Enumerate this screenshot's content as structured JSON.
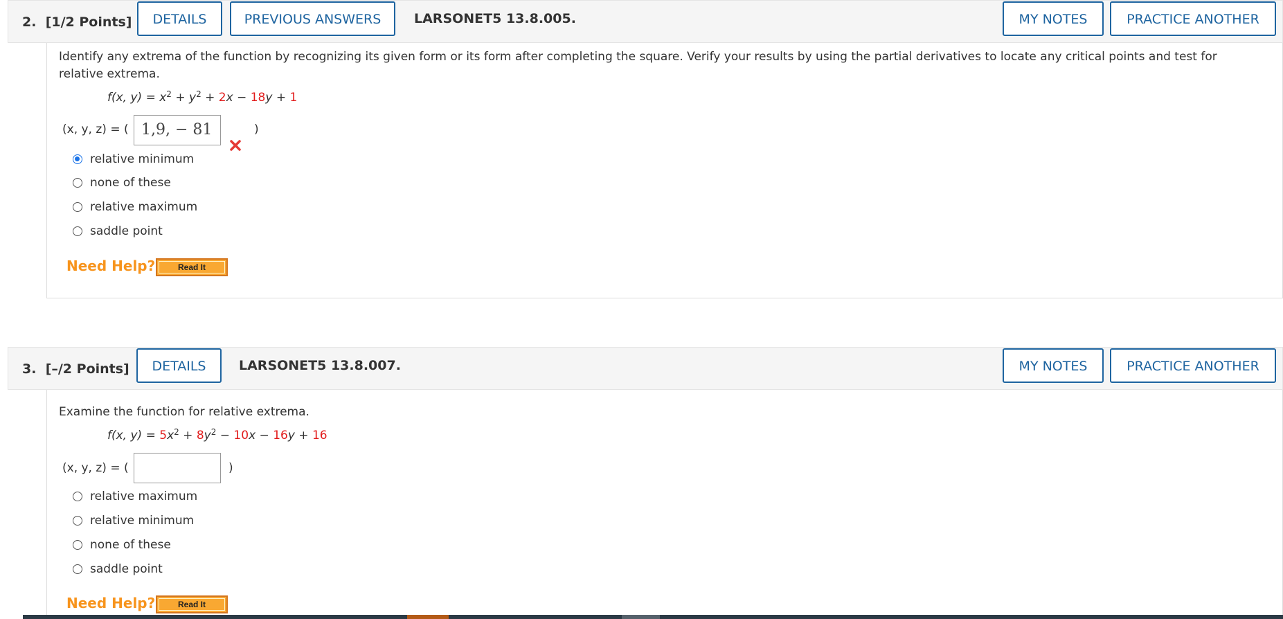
{
  "q2": {
    "number": "2.",
    "points": "[1/2 Points]",
    "buttons": {
      "details": "DETAILS",
      "previous_answers": "PREVIOUS ANSWERS",
      "my_notes": "MY NOTES",
      "practice_another": "PRACTICE ANOTHER"
    },
    "problem_id": "LARSONET5 13.8.005.",
    "prompt": "Identify any extrema of the function by recognizing its given form or its form after completing the square. Verify your results by using the partial derivatives to locate any critical points and test for relative extrema.",
    "formula": {
      "lhs": "f(x, y) = ",
      "x2": "x",
      "exp2": "2",
      "plus1": " + ",
      "y2": "y",
      "exp2b": "2",
      "plus2": " + ",
      "c1": "2",
      "x": "x",
      "minus": " − ",
      "c2": "18",
      "y": "y",
      "plus3": " + ",
      "c3": "1"
    },
    "answer_label": "(x, y, z) = (",
    "answer_value": "1,9, − 81",
    "answer_status": "incorrect",
    "close_paren": ")",
    "options": [
      {
        "label": "relative minimum",
        "checked": true
      },
      {
        "label": "none of these",
        "checked": false
      },
      {
        "label": "relative maximum",
        "checked": false
      },
      {
        "label": "saddle point",
        "checked": false
      }
    ],
    "need_help": "Need Help?",
    "read_it": "Read It"
  },
  "q3": {
    "number": "3.",
    "points": "[–/2 Points]",
    "buttons": {
      "details": "DETAILS",
      "my_notes": "MY NOTES",
      "practice_another": "PRACTICE ANOTHER"
    },
    "problem_id": "LARSONET5 13.8.007.",
    "prompt": "Examine the function for relative extrema.",
    "formula": {
      "lhs": "f(x, y) = ",
      "c1": "5",
      "x2": "x",
      "exp2": "2",
      "plus1": " + ",
      "c2": "8",
      "y2": "y",
      "exp2b": "2",
      "minus1": " − ",
      "c3": "10",
      "x": "x",
      "minus2": " − ",
      "c4": "16",
      "y": "y",
      "plus2": " + ",
      "c5": "16"
    },
    "answer_label": "(x, y, z) = (",
    "answer_value": "",
    "close_paren": ")",
    "options": [
      {
        "label": "relative maximum",
        "checked": false
      },
      {
        "label": "relative minimum",
        "checked": false
      },
      {
        "label": "none of these",
        "checked": false
      },
      {
        "label": "saddle point",
        "checked": false
      }
    ],
    "need_help": "Need Help?",
    "read_it": "Read It"
  },
  "colors": {
    "accent_blue": "#1e64a0",
    "coefficient_red": "#e21b1b",
    "help_orange": "#f7941d",
    "wrong_red": "#e53935"
  }
}
